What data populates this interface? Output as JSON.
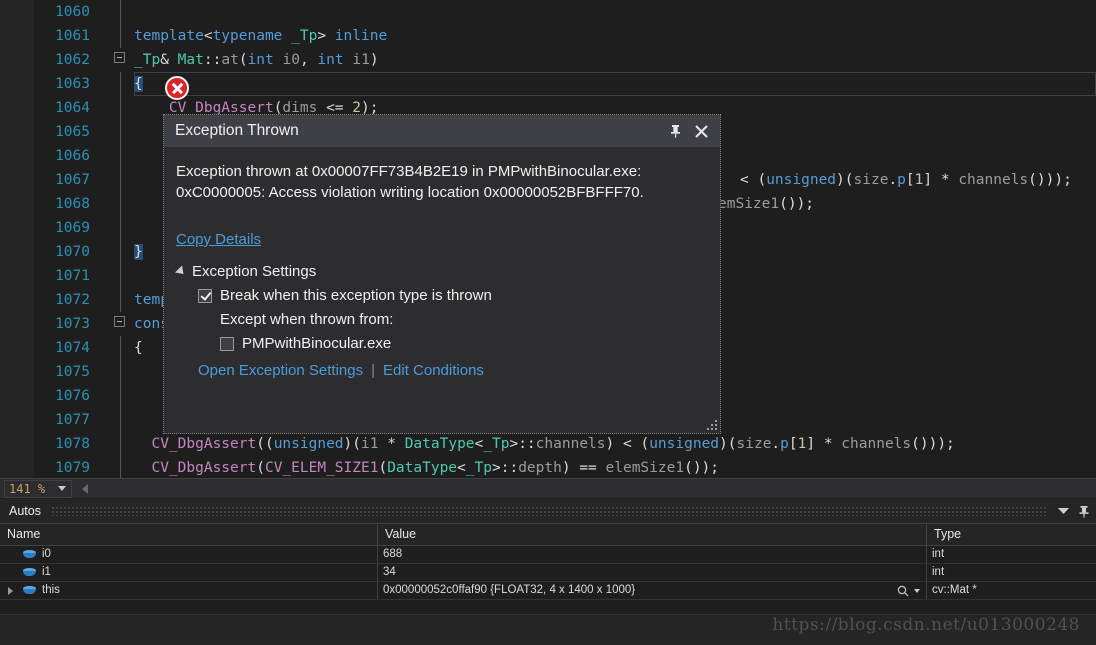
{
  "editor": {
    "zoom_level": "141 %",
    "lines": [
      {
        "num": "1060",
        "text": "",
        "fold": false
      },
      {
        "num": "1061",
        "text": "template<typename _Tp> inline",
        "fold": false
      },
      {
        "num": "1062",
        "text": "_Tp& Mat::at(int i0, int i1)",
        "fold": true
      },
      {
        "num": "1063",
        "text": "{",
        "fold": false,
        "current": true
      },
      {
        "num": "1064",
        "text": "    CV_DbgAssert(dims <= 2);",
        "fold": false
      },
      {
        "num": "1065",
        "text": "",
        "fold": false
      },
      {
        "num": "1066",
        "text": "",
        "fold": false
      },
      {
        "num": "1067",
        "text": "",
        "fold": false
      },
      {
        "num": "1068",
        "text": "",
        "fold": false
      },
      {
        "num": "1069",
        "text": "",
        "fold": false
      },
      {
        "num": "1070",
        "text": "}",
        "fold": false
      },
      {
        "num": "1071",
        "text": "",
        "fold": false
      },
      {
        "num": "1072",
        "text": "template",
        "fold": false
      },
      {
        "num": "1073",
        "text": "const",
        "fold": true
      },
      {
        "num": "1074",
        "text": "{",
        "fold": false
      },
      {
        "num": "1075",
        "text": "",
        "fold": false
      },
      {
        "num": "1076",
        "text": "",
        "fold": false
      },
      {
        "num": "1077",
        "text": "",
        "fold": false
      },
      {
        "num": "1078",
        "text": "    CV_DbgAssert((unsigned)(i1 * DataType<_Tp>::channels) < (unsigned)(size.p[1] * channels()));",
        "fold": false
      },
      {
        "num": "1079",
        "text": "    CV_DbgAssert(CV_ELEM_SIZE1(DataType<_Tp>::depth) == elemSize1());",
        "fold": false
      }
    ],
    "right_fragment_line1": "< (unsigned)(size.p[1] * channels()));",
    "right_fragment_line2": "emSize1());"
  },
  "exception_dialog": {
    "title": "Exception Thrown",
    "pin_icon": "pin-icon",
    "close_icon": "close-icon",
    "message": "Exception thrown at 0x00007FF73B4B2E19 in PMPwithBinocular.exe: 0xC0000005: Access violation writing location 0x00000052BFBFFF70.",
    "copy_details_label": "Copy Details",
    "settings_header": "Exception Settings",
    "break_checkbox_label": "Break when this exception type is thrown",
    "break_checkbox_checked": true,
    "except_from_label": "Except when thrown from:",
    "module_checkbox_label": "PMPwithBinocular.exe",
    "module_checkbox_checked": false,
    "open_settings_link": "Open Exception Settings",
    "link_separator": "|",
    "edit_conditions_link": "Edit Conditions"
  },
  "autos": {
    "title": "Autos",
    "dropdown_icon": "chevron-down-icon",
    "pin_icon": "pin-icon",
    "columns": [
      "Name",
      "Value",
      "Type"
    ],
    "rows": [
      {
        "name": "i0",
        "value": "688",
        "type": "int",
        "expandable": false,
        "magnifier": false
      },
      {
        "name": "i1",
        "value": "34",
        "type": "int",
        "expandable": false,
        "magnifier": false
      },
      {
        "name": "this",
        "value": "0x00000052c0ffaf90 {FLOAT32, 4 x 1400 x 1000}",
        "type": "cv::Mat *",
        "expandable": true,
        "magnifier": true
      }
    ]
  },
  "watermark": "https://blog.csdn.net/u013000248",
  "colors": {
    "accent_link": "#4a9ddb",
    "error_red": "#d9242a",
    "current_line_arrow": "#f1c40f",
    "keyword_blue": "#569cd6",
    "type_green": "#4ec9b0",
    "macro_pink": "#c586c0",
    "linenum_teal": "#2b91af"
  }
}
